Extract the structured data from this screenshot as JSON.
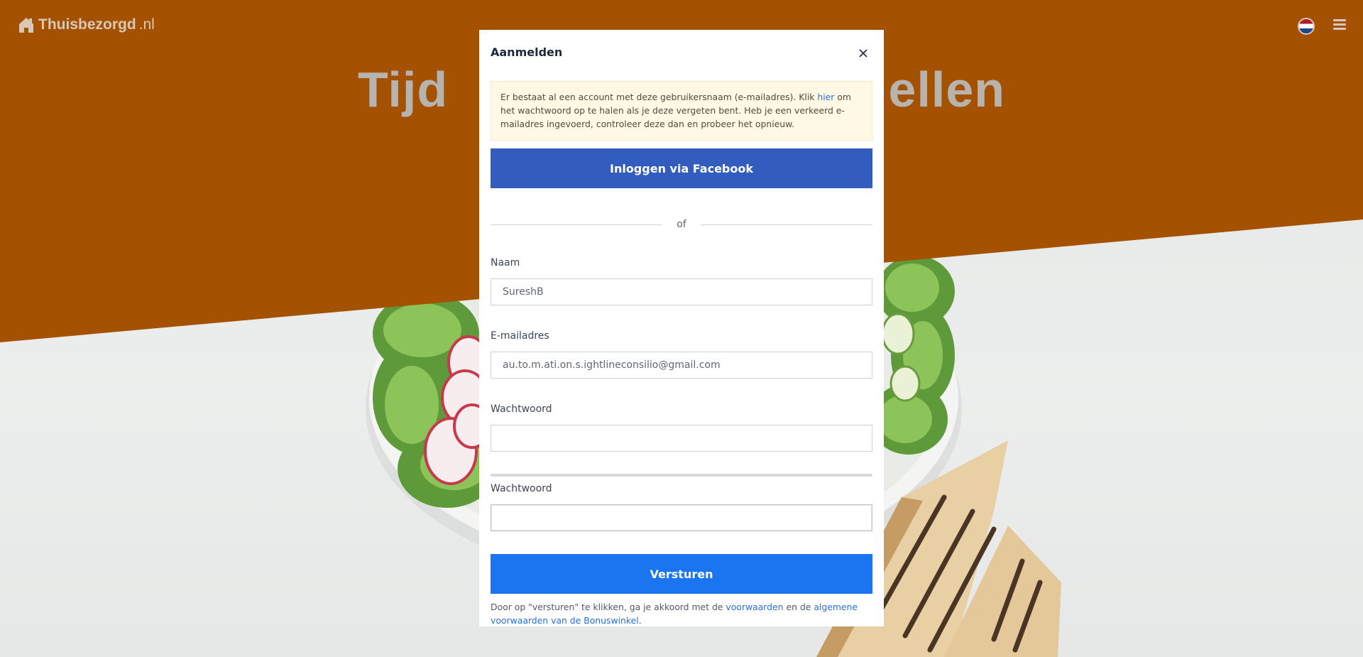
{
  "header": {
    "logo_name": "Thuisbezorgd",
    "logo_tld": ".nl",
    "language_icon": "netherlands-flag-icon",
    "menu_icon": "hamburger-menu-icon"
  },
  "hero": {
    "title": "Tijd ellen"
  },
  "modal": {
    "title": "Aanmelden",
    "close_icon": "close-icon",
    "alert": {
      "text_before_link": "Er bestaat al een account met deze gebruikersnaam (e-mailadres). Klik ",
      "link_text": "hier",
      "text_after_link": " om het wachtwoord op te halen als je deze vergeten bent. Heb je een verkeerd e-mailadres ingevoerd, controleer deze dan en probeer het opnieuw."
    },
    "facebook_button": "Inloggen via Facebook",
    "divider_text": "of",
    "fields": {
      "name": {
        "label": "Naam",
        "value": "SureshB"
      },
      "email": {
        "label": "E-mailadres",
        "value": "au.to.m.ati.on.s.ightlineconsilio@gmail.com"
      },
      "password": {
        "label": "Wachtwoord",
        "value": ""
      },
      "password_confirm": {
        "label": "Wachtwoord",
        "value": ""
      }
    },
    "password_strength": 0,
    "submit_button": "Versturen",
    "terms": {
      "text_before": "Door op \"versturen\" te klikken, ga je akkoord met de ",
      "link1": "voorwaarden",
      "text_middle": " en de ",
      "link2": "algemene voorwaarden van de Bonuswinkel",
      "text_after": "."
    }
  },
  "colors": {
    "brand_orange": "#a45202",
    "facebook_blue": "#325cbe",
    "primary_blue": "#1b74f0",
    "alert_bg": "#fef8e4",
    "link_blue": "#2a6fd8"
  }
}
